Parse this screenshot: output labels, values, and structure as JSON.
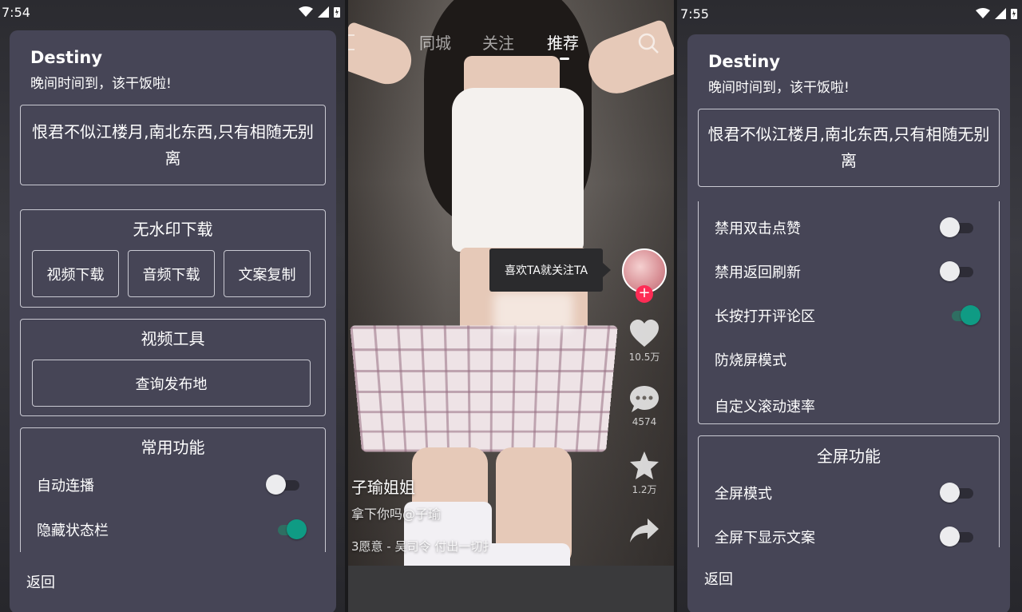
{
  "left_phone": {
    "status_time": "7:54",
    "dialog": {
      "title": "Destiny",
      "subtitle": "晚间时间到，该干饭啦!",
      "quote": "恨君不似江楼月,南北东西,只有相随无别离",
      "sections": {
        "download": {
          "title": "无水印下载",
          "buttons": [
            "视频下载",
            "音频下载",
            "文案复制"
          ]
        },
        "video_tools": {
          "title": "视频工具",
          "button": "查询发布地"
        },
        "common": {
          "title": "常用功能",
          "items": [
            {
              "label": "自动连播",
              "on": false
            },
            {
              "label": "隐藏状态栏",
              "on": true
            }
          ]
        }
      },
      "back_label": "返回"
    }
  },
  "middle_phone": {
    "tabs": [
      "同城",
      "关注",
      "推荐"
    ],
    "active_tab": "推荐",
    "tooltip": "喜欢TA就关注TA",
    "likes": "10.5万",
    "comments": "4574",
    "favorites": "1.2万",
    "author": "子瑜姐姐",
    "description": "拿下你吗@子瑜",
    "music": "3愿意 - 吴司令   付出一切扌",
    "icons": [
      "search-icon",
      "heart-icon",
      "comment-icon",
      "star-icon",
      "share-icon"
    ]
  },
  "right_phone": {
    "status_time": "7:55",
    "dialog": {
      "title": "Destiny",
      "subtitle": "晚间时间到，该干饭啦!",
      "quote": "恨君不似江楼月,南北东西,只有相随无别离",
      "settings": [
        {
          "label": "禁用双击点赞",
          "toggle": true,
          "on": false
        },
        {
          "label": "禁用返回刷新",
          "toggle": true,
          "on": false
        },
        {
          "label": "长按打开评论区",
          "toggle": true,
          "on": true
        },
        {
          "label": "防烧屏模式",
          "toggle": false
        },
        {
          "label": "自定义滚动速率",
          "toggle": false
        }
      ],
      "fullscreen": {
        "title": "全屏功能",
        "items": [
          {
            "label": "全屏模式",
            "on": false
          },
          {
            "label": "全屏下显示文案",
            "on": false
          }
        ]
      },
      "back_label": "返回"
    }
  },
  "colors": {
    "dialog_bg": "#464556",
    "toggle_on": "#0f9b84",
    "follow_plus": "#fe2c55"
  }
}
